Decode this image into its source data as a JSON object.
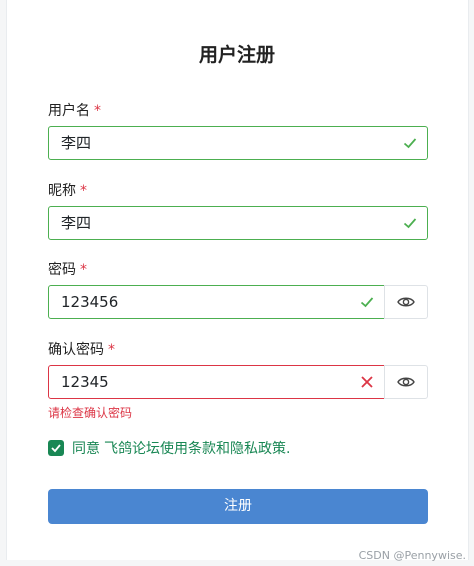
{
  "form": {
    "title": "用户注册",
    "username": {
      "label": "用户名",
      "required": "*",
      "value": "李四",
      "status": "valid"
    },
    "nickname": {
      "label": "昵称",
      "required": "*",
      "value": "李四",
      "status": "valid"
    },
    "password": {
      "label": "密码",
      "required": "*",
      "value": "123456",
      "status": "valid"
    },
    "confirm": {
      "label": "确认密码",
      "required": "*",
      "value": "12345",
      "status": "invalid",
      "error": "请检查确认密码"
    },
    "agree": {
      "checked": true,
      "prefix": "同意",
      "link": "飞鸽论坛使用条款和隐私政策."
    },
    "submit_label": "注册"
  },
  "watermark": "CSDN @Pennywise.",
  "colors": {
    "valid": "#4caf50",
    "invalid": "#dc3545",
    "primary": "#4a86d1",
    "agree": "#198754"
  }
}
